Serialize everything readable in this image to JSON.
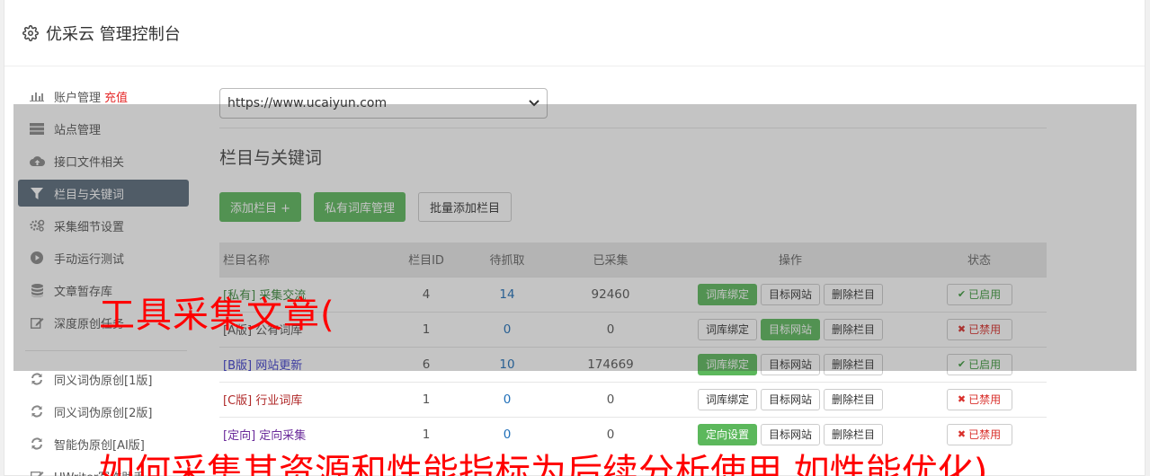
{
  "header": {
    "title": "优采云 管理控制台",
    "icon": "gear-icon"
  },
  "sidebar": {
    "items": [
      {
        "label": "账户管理",
        "extra": "充值",
        "icon": "bar-chart-icon"
      },
      {
        "label": "站点管理",
        "icon": "server-icon"
      },
      {
        "label": "接口文件相关",
        "icon": "cloud-upload-icon"
      },
      {
        "label": "栏目与关键词",
        "icon": "filter-icon",
        "active": true
      },
      {
        "label": "采集细节设置",
        "icon": "cogs-icon"
      },
      {
        "label": "手动运行测试",
        "icon": "play-circle-icon"
      },
      {
        "label": "文章暂存库",
        "icon": "database-icon"
      },
      {
        "label": "深度原创任务",
        "icon": "edit-icon"
      }
    ],
    "items2": [
      {
        "label": "同义词伪原创[1版]",
        "icon": "refresh-icon"
      },
      {
        "label": "同义词伪原创[2版]",
        "icon": "refresh-icon"
      },
      {
        "label": "智能伪原创[AI版]",
        "icon": "refresh-icon"
      },
      {
        "label": "UWriter写作助手",
        "icon": "edit-icon"
      }
    ]
  },
  "main": {
    "site_select": "https://www.ucaiyun.com",
    "section_title": "栏目与关键词",
    "buttons": {
      "add": "添加栏目 +",
      "lexicon": "私有词库管理",
      "batch": "批量添加栏目"
    },
    "table": {
      "headers": {
        "name": "栏目名称",
        "id": "栏目ID",
        "pending": "待抓取",
        "collected": "已采集",
        "ops": "操作",
        "status": "状态"
      },
      "rows": [
        {
          "name": "[私有] 采集交流",
          "id": "4",
          "pending": "14",
          "collected": "92460",
          "op1": "词库绑定",
          "op2": "目标网站",
          "op3": "删除栏目",
          "status": "已启用"
        },
        {
          "name": "[A版] 公有词库",
          "id": "1",
          "pending": "0",
          "collected": "0",
          "op1": "词库绑定",
          "op2": "目标网站",
          "op3": "删除栏目",
          "status": "已禁用"
        },
        {
          "name": "[B版] 网站更新",
          "id": "6",
          "pending": "10",
          "collected": "174669",
          "op1": "词库绑定",
          "op2": "目标网站",
          "op3": "删除栏目",
          "status": "已启用"
        },
        {
          "name": "[C版] 行业词库",
          "id": "1",
          "pending": "0",
          "collected": "0",
          "op1": "词库绑定",
          "op2": "目标网站",
          "op3": "删除栏目",
          "status": "已禁用"
        },
        {
          "name": "[定向] 定向采集",
          "id": "1",
          "pending": "0",
          "collected": "0",
          "op1": "定向设置",
          "op2": "目标网站",
          "op3": "删除栏目",
          "status": "已禁用"
        }
      ]
    }
  },
  "watermark": {
    "line1": "工具采集文章(",
    "line2": "如何采集其资源和性能指标为后续分析使用,如性能优化)"
  },
  "colors": {
    "accent_green": "#5cb85c",
    "active_nav": "#5a6a7a",
    "watermark_red": "#ff0000",
    "link_blue": "#1f6fb8"
  }
}
